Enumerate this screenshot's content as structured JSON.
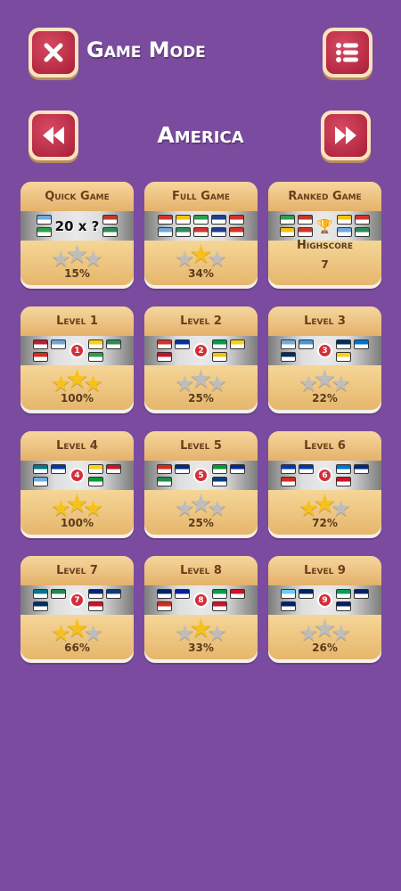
{
  "header": {
    "title": "Game Mode",
    "close_icon": "close-icon",
    "menu_icon": "list-menu-icon"
  },
  "region": {
    "title": "America",
    "prev_icon": "double-chevron-left-icon",
    "next_icon": "double-chevron-right-icon"
  },
  "modes": [
    {
      "label": "Quick Game",
      "multiplier": "20 x ?",
      "flags_left": [
        "#6fa8dc",
        "#2e9e4b"
      ],
      "flags_right": [
        "#c0392b",
        "#2e8b57"
      ],
      "stars": 0,
      "percent": "15%"
    },
    {
      "label": "Full Game",
      "flags": [
        "#d0342c",
        "#f4c20d",
        "#2e9e4b",
        "#1d3f8f",
        "#d0342c",
        "#6fa8dc",
        "#2e8b57",
        "#d0342c",
        "#1d3f8f",
        "#d0342c"
      ],
      "stars": 1,
      "percent": "34%"
    },
    {
      "label": "Ranked Game",
      "flags": [
        "#2e9e4b",
        "#c0392b",
        "#f4c20d",
        "#d0342c",
        "#6fa8dc",
        "#2e8b57"
      ],
      "trophy_icon": "trophy-icon",
      "highscore_label": "Highscore",
      "highscore_value": "7"
    }
  ],
  "levels": [
    {
      "label": "Level 1",
      "number": "1",
      "stars": 3,
      "percent": "100%",
      "flags_left": [
        "#b22234",
        "#6fa8dc",
        "#d52b1e"
      ],
      "flags_right": [
        "#fcd116",
        "#2e8b57",
        "#2e9e4b"
      ]
    },
    {
      "label": "Level 2",
      "number": "2",
      "stars": 0,
      "percent": "25%",
      "flags_left": [
        "#d0342c",
        "#0033a0",
        "#c8102e"
      ],
      "flags_right": [
        "#009e49",
        "#fcd116",
        "#f4c20d"
      ]
    },
    {
      "label": "Level 3",
      "number": "3",
      "stars": 0,
      "percent": "22%",
      "flags_left": [
        "#74acdf",
        "#4997d0",
        "#002d62"
      ],
      "flags_right": [
        "#002d62",
        "#0073cf",
        "#fcd116"
      ]
    },
    {
      "label": "Level 4",
      "number": "4",
      "stars": 3,
      "percent": "100%",
      "flags_left": [
        "#00778b",
        "#0038a8",
        "#74acdf"
      ],
      "flags_right": [
        "#fcd116",
        "#ce1126",
        "#009b3a"
      ]
    },
    {
      "label": "Level 5",
      "number": "5",
      "stars": 0,
      "percent": "25%",
      "flags_left": [
        "#d52b1e",
        "#002b7f",
        "#1f8a4c"
      ],
      "flags_right": [
        "#009b3a",
        "#002a8f",
        "#003f87"
      ]
    },
    {
      "label": "Level 6",
      "number": "6",
      "stars": 2,
      "percent": "72%",
      "flags_left": [
        "#0038a8",
        "#0038a8",
        "#d52b1e"
      ],
      "flags_right": [
        "#0073cf",
        "#002b7f",
        "#ce1126"
      ]
    },
    {
      "label": "Level 7",
      "number": "7",
      "stars": 2,
      "percent": "66%",
      "flags_left": [
        "#00778b",
        "#1f8a4c",
        "#002d62"
      ],
      "flags_right": [
        "#00267f",
        "#0a3a7a",
        "#ce1126"
      ]
    },
    {
      "label": "Level 8",
      "number": "8",
      "stars": 1,
      "percent": "33%",
      "flags_left": [
        "#012169",
        "#00209f",
        "#d52b1e"
      ],
      "flags_right": [
        "#009e49",
        "#ce1126",
        "#ce1126"
      ]
    },
    {
      "label": "Level 9",
      "number": "9",
      "stars": 0,
      "percent": "26%",
      "flags_left": [
        "#66ccff",
        "#012169",
        "#012169"
      ],
      "flags_right": [
        "#009e60",
        "#012169",
        "#012169"
      ]
    }
  ],
  "colors": {
    "background": "#7a4b9e",
    "button_red": "#c22a43",
    "star_gold": "#f6c11a",
    "star_grey": "#bdbdbd"
  }
}
